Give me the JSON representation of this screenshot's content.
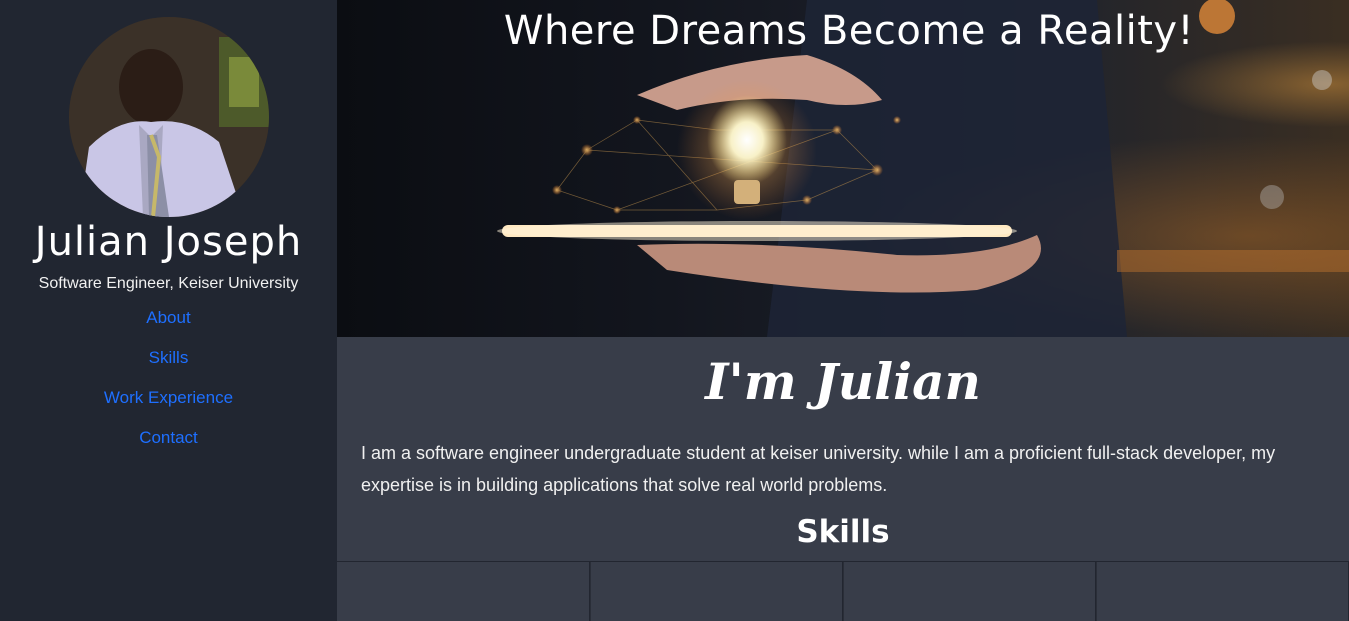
{
  "profile": {
    "name": "Julian Joseph",
    "subtitle": "Software Engineer, Keiser University"
  },
  "nav": {
    "items": [
      {
        "label": "About"
      },
      {
        "label": "Skills"
      },
      {
        "label": "Work Experience"
      },
      {
        "label": "Contact"
      }
    ]
  },
  "hero": {
    "title": "Where Dreams Become a Reality!"
  },
  "intro": {
    "heading": "I'm Julian",
    "text": "I am a software engineer undergraduate student at keiser university. while I am a proficient full-stack developer, my expertise is in building applications that solve real world problems."
  },
  "skills": {
    "heading": "Skills"
  },
  "colors": {
    "sidebar_bg": "#212631",
    "main_bg": "#383d49",
    "link": "#1e6fff"
  }
}
